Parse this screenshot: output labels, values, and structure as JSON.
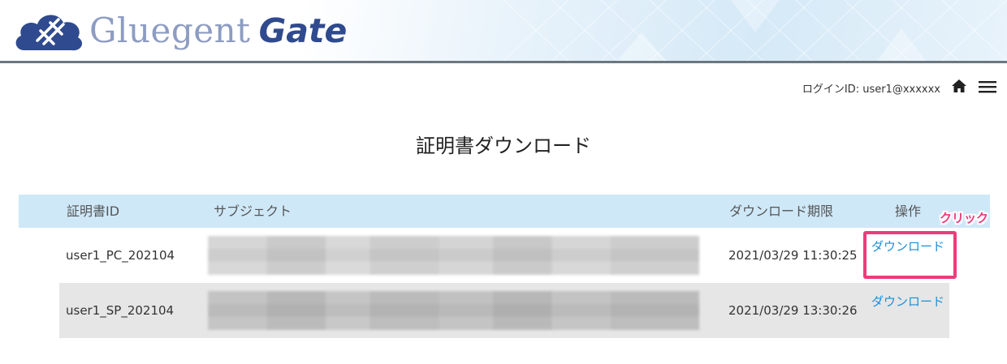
{
  "header": {
    "brand_main": "Gluegent",
    "brand_sub": "Gate"
  },
  "topbar": {
    "login_id": "ログインID: user1@xxxxxx",
    "home_icon": "home-icon",
    "menu_icon": "hamburger-menu-icon"
  },
  "page": {
    "title": "証明書ダウンロード"
  },
  "table": {
    "headers": {
      "cert_id": "証明書ID",
      "subject": "サブジェクト",
      "expiry": "ダウンロード期限",
      "action": "操作"
    },
    "rows": [
      {
        "cert_id": "user1_PC_202104",
        "expiry": "2021/03/29 11:30:25",
        "action": "ダウンロード"
      },
      {
        "cert_id": "user1_SP_202104",
        "expiry": "2021/03/29 13:30:26",
        "action": "ダウンロード"
      }
    ]
  },
  "annotation": {
    "click_label": "クリック",
    "color": "#ef3b7b"
  },
  "colors": {
    "header_rule": "#6b7780",
    "table_header_bg": "#cfe8f8",
    "link": "#1a8fd6",
    "brand_navy": "#2f4a8e",
    "brand_light": "#8d9cc2"
  }
}
